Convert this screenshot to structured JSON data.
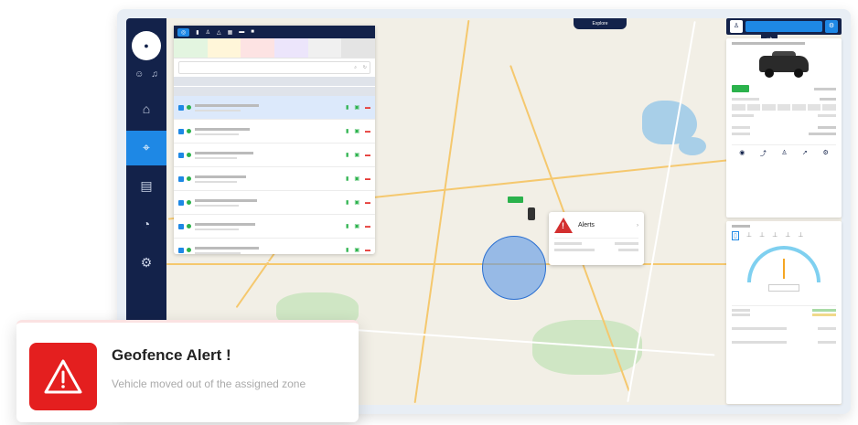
{
  "toast": {
    "title": "Geofence Alert !",
    "message": "Vehicle moved out of the assigned zone"
  },
  "map": {
    "top_button": "Explore"
  },
  "popup": {
    "title": "Alerts"
  }
}
